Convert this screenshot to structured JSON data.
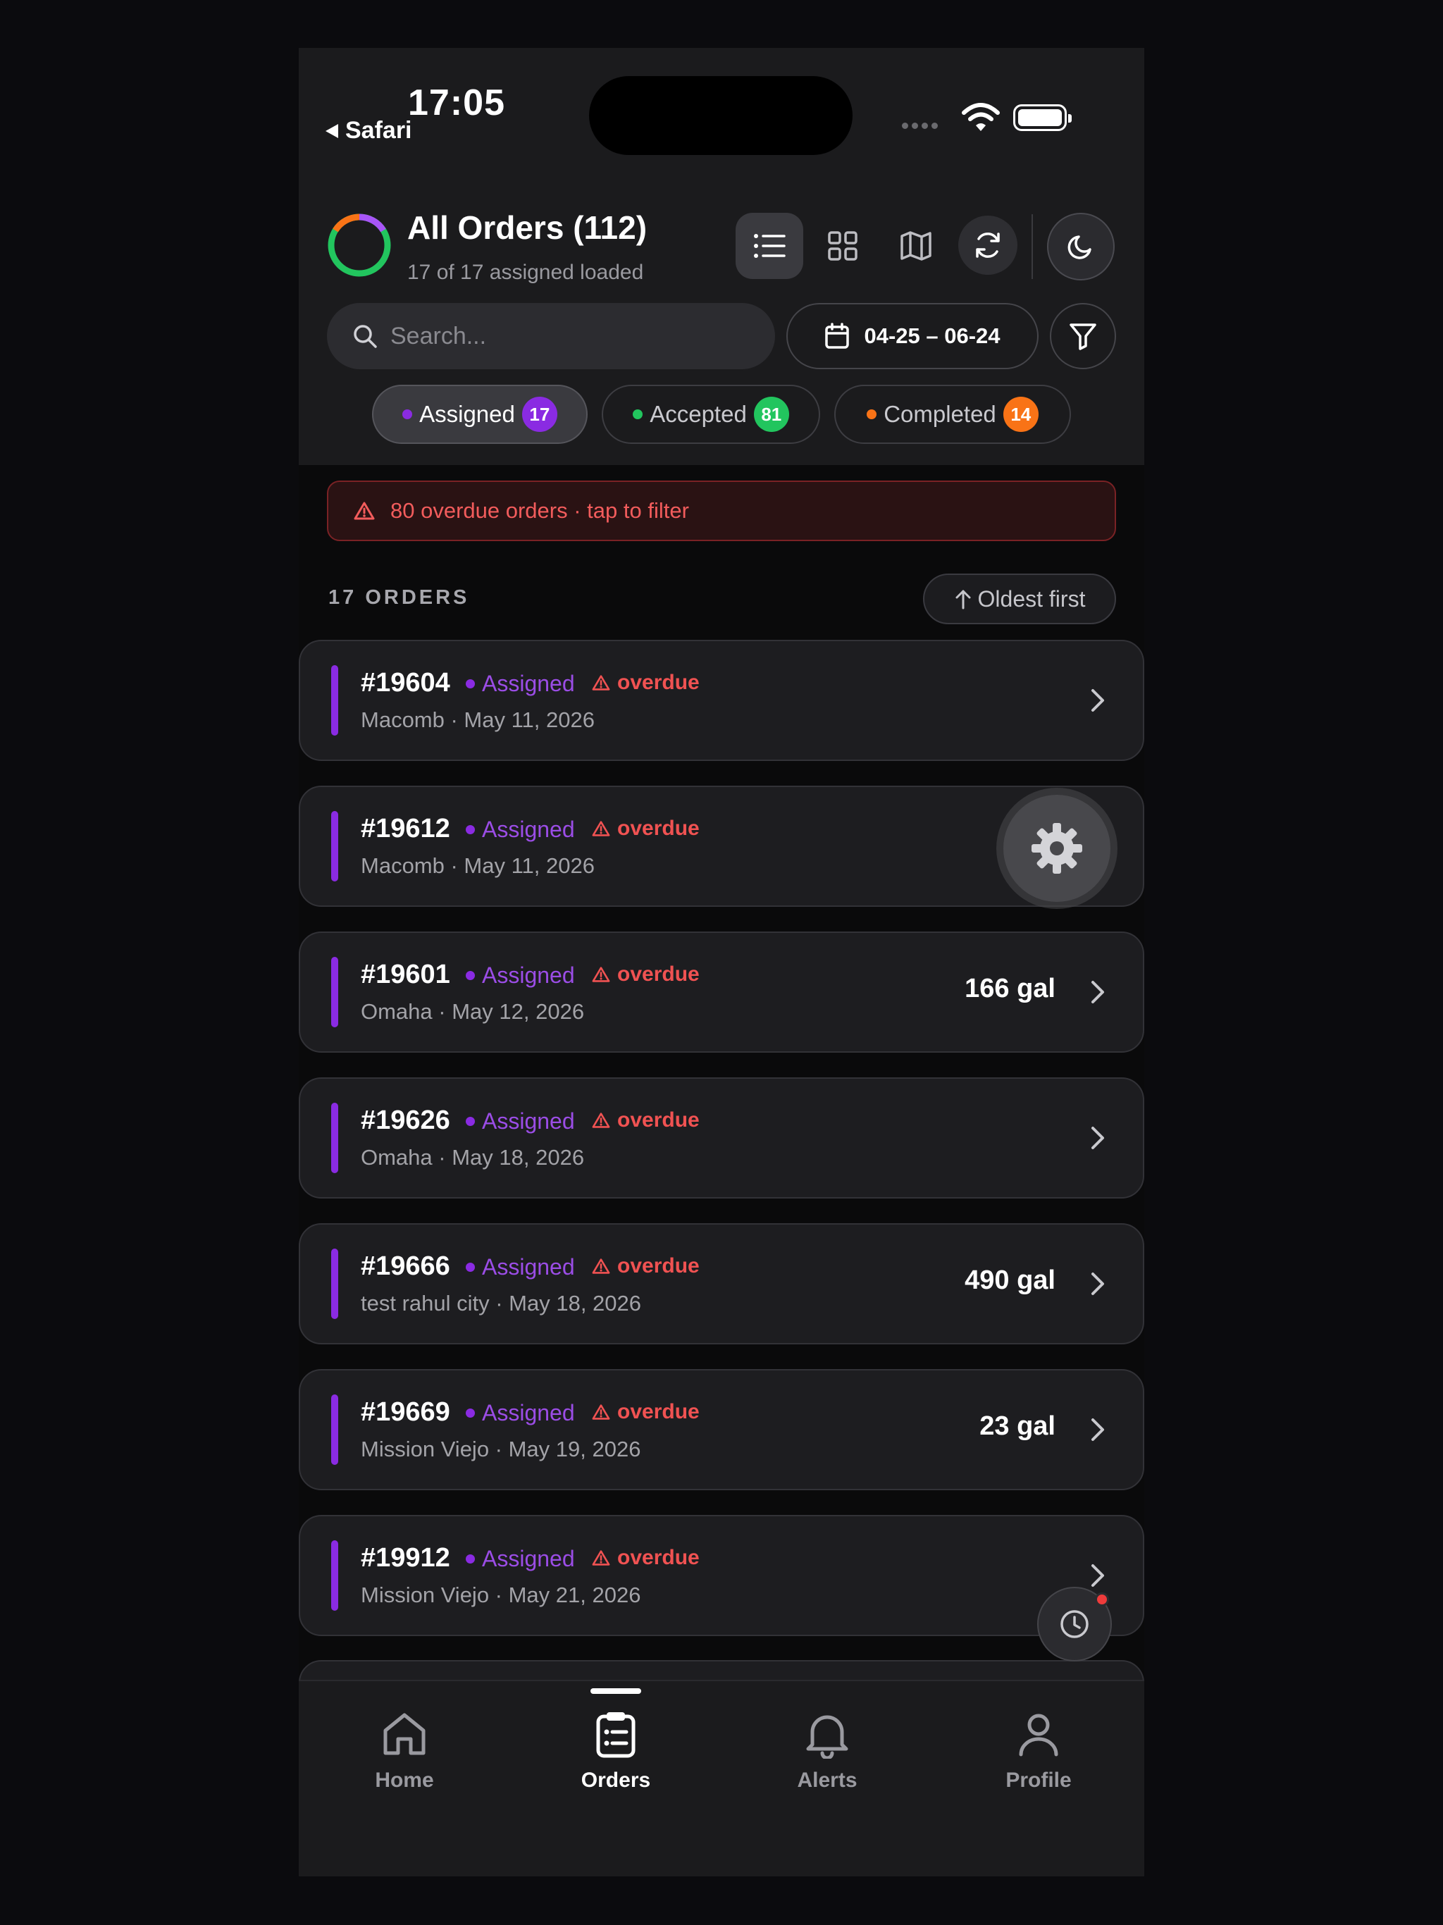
{
  "status_bar": {
    "time": "17:05",
    "back_label": "Safari"
  },
  "header": {
    "title": "All Orders (112)",
    "subtitle": "17 of 17 assigned loaded",
    "view_buttons": [
      "list-view",
      "grid-view",
      "map-view",
      "refresh",
      "theme-toggle"
    ]
  },
  "search": {
    "placeholder": "Search..."
  },
  "date_range": "04-25 – 06-24",
  "tabs": [
    {
      "label": "Assigned",
      "count": "17",
      "color": "#8a2be2",
      "selected": true
    },
    {
      "label": "Accepted",
      "count": "81",
      "color": "#22c55e",
      "selected": false
    },
    {
      "label": "Completed",
      "count": "14",
      "color": "#f97316",
      "selected": false
    }
  ],
  "banner": {
    "text": "80 overdue orders · tap to filter"
  },
  "list": {
    "count_label": "17 ORDERS",
    "sort_label": "Oldest first"
  },
  "orders": [
    {
      "number": "#19604",
      "status": "Assigned",
      "flag": "overdue",
      "meta": "Macomb · May 11, 2026",
      "volume": ""
    },
    {
      "number": "#19612",
      "status": "Assigned",
      "flag": "overdue",
      "meta": "Macomb · May 11, 2026",
      "volume": ""
    },
    {
      "number": "#19601",
      "status": "Assigned",
      "flag": "overdue",
      "meta": "Omaha · May 12, 2026",
      "volume": "166 gal"
    },
    {
      "number": "#19626",
      "status": "Assigned",
      "flag": "overdue",
      "meta": "Omaha · May 18, 2026",
      "volume": ""
    },
    {
      "number": "#19666",
      "status": "Assigned",
      "flag": "overdue",
      "meta": "test rahul city · May 18, 2026",
      "volume": "490 gal"
    },
    {
      "number": "#19669",
      "status": "Assigned",
      "flag": "overdue",
      "meta": "Mission Viejo · May 19, 2026",
      "volume": "23 gal"
    },
    {
      "number": "#19912",
      "status": "Assigned",
      "flag": "overdue",
      "meta": "Mission Viejo · May 21, 2026",
      "volume": ""
    }
  ],
  "nav": [
    {
      "label": "Home",
      "icon": "home-icon",
      "active": false
    },
    {
      "label": "Orders",
      "icon": "clipboard-icon",
      "active": true
    },
    {
      "label": "Alerts",
      "icon": "bell-icon",
      "active": false
    },
    {
      "label": "Profile",
      "icon": "user-icon",
      "active": false
    }
  ],
  "colors": {
    "accent": "#8a2be2",
    "danger": "#f05252",
    "success": "#22c55e",
    "warning": "#f97316"
  }
}
